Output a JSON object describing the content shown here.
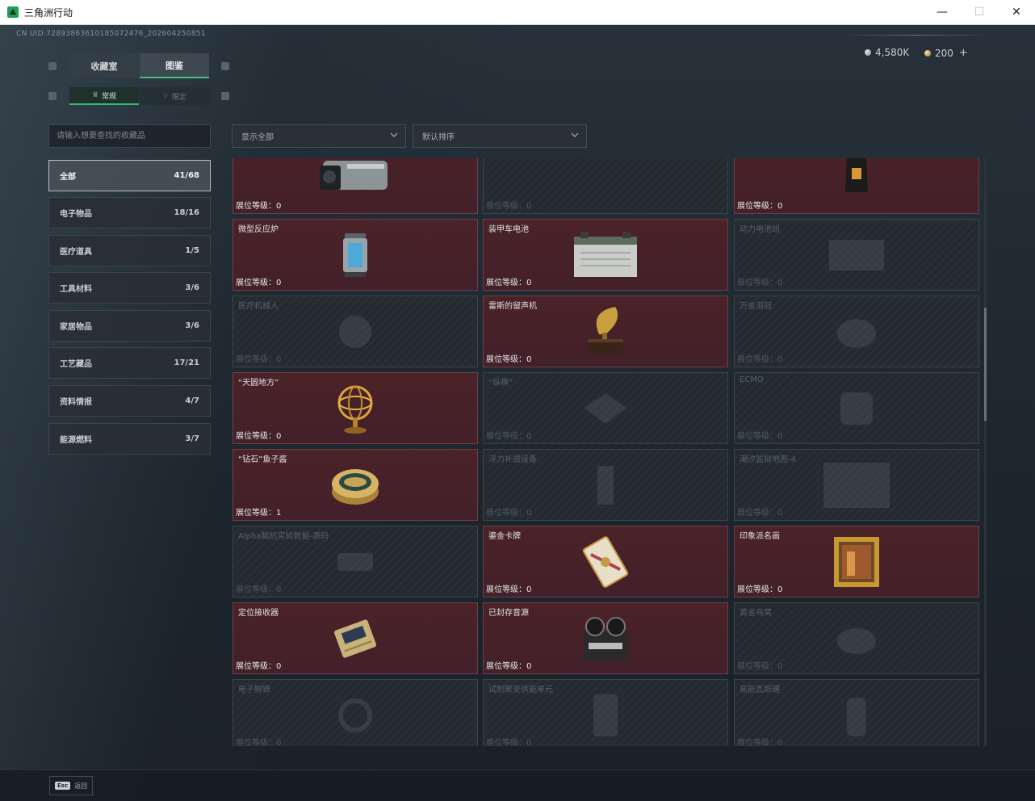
{
  "window": {
    "title": "三角洲行动"
  },
  "uid": "CN UID:7289386361018507247​6_202604250851",
  "currency": {
    "silver": "4,580K",
    "gold": "200",
    "plus": "+"
  },
  "tabs": {
    "collection": "收藏室",
    "catalog": "图鉴"
  },
  "subtabs": {
    "normal": "常规",
    "limited": "限定"
  },
  "search": {
    "placeholder": "请输入想要查找的收藏品"
  },
  "filters": {
    "show": "显示全部",
    "sort": "默认排序"
  },
  "categories": [
    {
      "label": "全部",
      "count": "41/68"
    },
    {
      "label": "电子物品",
      "count": "18/16"
    },
    {
      "label": "医疗道具",
      "count": "1/5"
    },
    {
      "label": "工具材料",
      "count": "3/6"
    },
    {
      "label": "家居物品",
      "count": "3/6"
    },
    {
      "label": "工艺藏品",
      "count": "17/21"
    },
    {
      "label": "资料情报",
      "count": "4/7"
    },
    {
      "label": "能源燃料",
      "count": "3/7"
    }
  ],
  "cards": [
    {
      "name": "",
      "level": "展位等级：0"
    },
    {
      "name": "",
      "level": "展位等级：0"
    },
    {
      "name": "",
      "level": "展位等级：0"
    },
    {
      "name": "微型反应炉",
      "level": "展位等级：0"
    },
    {
      "name": "装甲车电池",
      "level": "展位等级：0"
    },
    {
      "name": "动力电池组",
      "level": "展位等级：0"
    },
    {
      "name": "医疗机械人",
      "level": "展位等级：0"
    },
    {
      "name": "雷斯的留声机",
      "level": "展位等级：0"
    },
    {
      "name": "万金泪冠",
      "level": "展位等级：0"
    },
    {
      "name": "“天圆地方”",
      "level": "展位等级：0"
    },
    {
      "name": "“纵横”",
      "level": "展位等级：0"
    },
    {
      "name": "ECMO",
      "level": "展位等级：0"
    },
    {
      "name": "“钻石”鱼子酱",
      "level": "展位等级：1"
    },
    {
      "name": "浮力补偿设备",
      "level": "展位等级：0"
    },
    {
      "name": "潮汐监狱地图-4",
      "level": "展位等级：0"
    },
    {
      "name": "Alpha脑机实验数据-源码",
      "level": "展位等级：0"
    },
    {
      "name": "鎏金卡牌",
      "level": "展位等级：0"
    },
    {
      "name": "印象派名画",
      "level": "展位等级：0"
    },
    {
      "name": "定位接收器",
      "level": "展位等级：0"
    },
    {
      "name": "已封存音源",
      "level": "展位等级：0"
    },
    {
      "name": "黄金鸟窝",
      "level": "展位等级：0"
    },
    {
      "name": "电子脚镣",
      "level": "展位等级：0"
    },
    {
      "name": "试制聚变供能单元",
      "level": "展位等级：0"
    },
    {
      "name": "高能瓦斯罐",
      "level": "展位等级：0"
    }
  ],
  "esc": {
    "key": "Esc",
    "label": "返回"
  },
  "colors": {
    "accent": "#41c285",
    "owned": "#4a2227",
    "locked": "#232a30"
  }
}
